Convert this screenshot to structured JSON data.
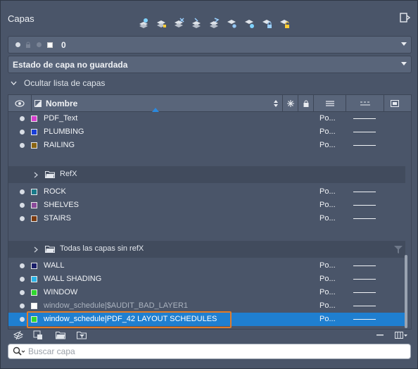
{
  "panel": {
    "title": "Capas"
  },
  "toolbar": {
    "icons": [
      "new-layer-icon",
      "new-layer-vp-frozen-icon",
      "delete-layer-icon",
      "set-current-icon",
      "layer-walk-icon",
      "freeze-icon",
      "lock-icon",
      "unlock-icon",
      "isolate-icon"
    ]
  },
  "current_layer": {
    "name": "0"
  },
  "layer_state": {
    "value": "Estado de capa no guardada"
  },
  "collapse": {
    "label": "Ocultar lista de capas"
  },
  "columns": {
    "name": "Nombre"
  },
  "rows_top": [
    {
      "name": "PDF_Text",
      "color": "#d63fcf",
      "plot": "Po..."
    },
    {
      "name": "PLUMBING",
      "color": "#1a3fd8",
      "plot": "Po..."
    },
    {
      "name": "RAILING",
      "color": "#8a6412",
      "plot": "Po..."
    }
  ],
  "group_refx": {
    "label": "RefX"
  },
  "rows_mid": [
    {
      "name": "ROCK",
      "color": "#1a7a8a",
      "plot": "Po..."
    },
    {
      "name": "SHELVES",
      "color": "#8a4a9a",
      "plot": "Po..."
    },
    {
      "name": "STAIRS",
      "color": "#7a3a10",
      "plot": "Po..."
    }
  ],
  "group_all": {
    "label": "Todas las capas sin refX"
  },
  "rows_bottom": [
    {
      "name": "WALL",
      "color": "#1a1f6a",
      "plot": "Po..."
    },
    {
      "name": "WALL SHADING",
      "color": "#2ab4e8",
      "plot": "Po..."
    },
    {
      "name": "WINDOW",
      "color": "#2fd82f",
      "plot": "Po..."
    },
    {
      "name": "window_schedule|$AUDIT_BAD_LAYER1",
      "color": "#ffffff",
      "plot": "Po..."
    },
    {
      "name": "window_schedule|PDF_42 LAYOUT SCHEDULES",
      "color": "#2fd82f",
      "plot": "Po..."
    }
  ],
  "search": {
    "placeholder": "Buscar capa"
  }
}
